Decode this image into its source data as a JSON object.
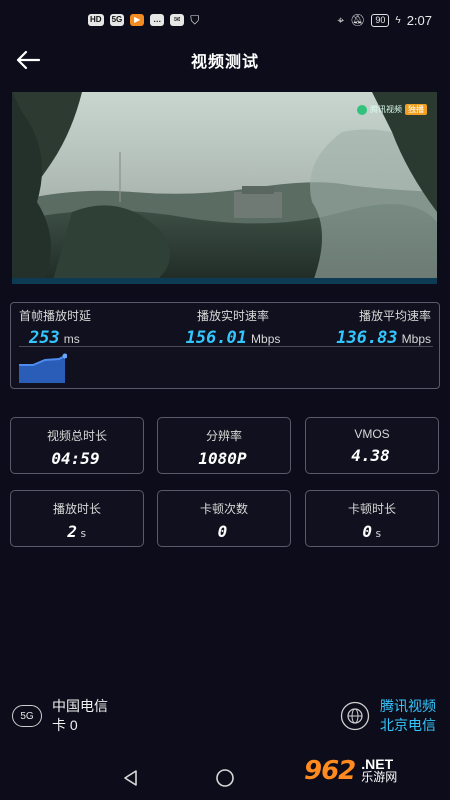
{
  "status_bar": {
    "left_chips": [
      "HD",
      "5G"
    ],
    "battery": "90",
    "time": "2:07"
  },
  "header": {
    "title": "视频测试",
    "back_icon": "arrow-left-icon"
  },
  "video": {
    "logo_text": "腾讯视频",
    "logo_tag": "独播"
  },
  "metrics": {
    "first_frame_delay": {
      "label": "首帧播放时延",
      "value": "253",
      "unit": "ms"
    },
    "realtime_rate": {
      "label": "播放实时速率",
      "value": "156.01",
      "unit": "Mbps"
    },
    "average_rate": {
      "label": "播放平均速率",
      "value": "136.83",
      "unit": "Mbps"
    },
    "colors": {
      "accent": "#33c7ff",
      "chart_fill": "#2a5db8"
    }
  },
  "cards": [
    {
      "label": "视频总时长",
      "value": "04:59",
      "unit": ""
    },
    {
      "label": "分辨率",
      "value": "1080P",
      "unit": ""
    },
    {
      "label": "VMOS",
      "value": "4.38",
      "unit": ""
    },
    {
      "label": "播放时长",
      "value": "2",
      "unit": "s"
    },
    {
      "label": "卡顿次数",
      "value": "0",
      "unit": ""
    },
    {
      "label": "卡顿时长",
      "value": "0",
      "unit": "s"
    }
  ],
  "carrier": {
    "network_badge": "5G",
    "name": "中国电信",
    "card": "卡 0"
  },
  "source": {
    "platform": "腾讯视频",
    "server": "北京电信",
    "icon": "globe-icon"
  },
  "watermark": {
    "brand": "962",
    "net": ".NET",
    "sub": "乐游网"
  }
}
